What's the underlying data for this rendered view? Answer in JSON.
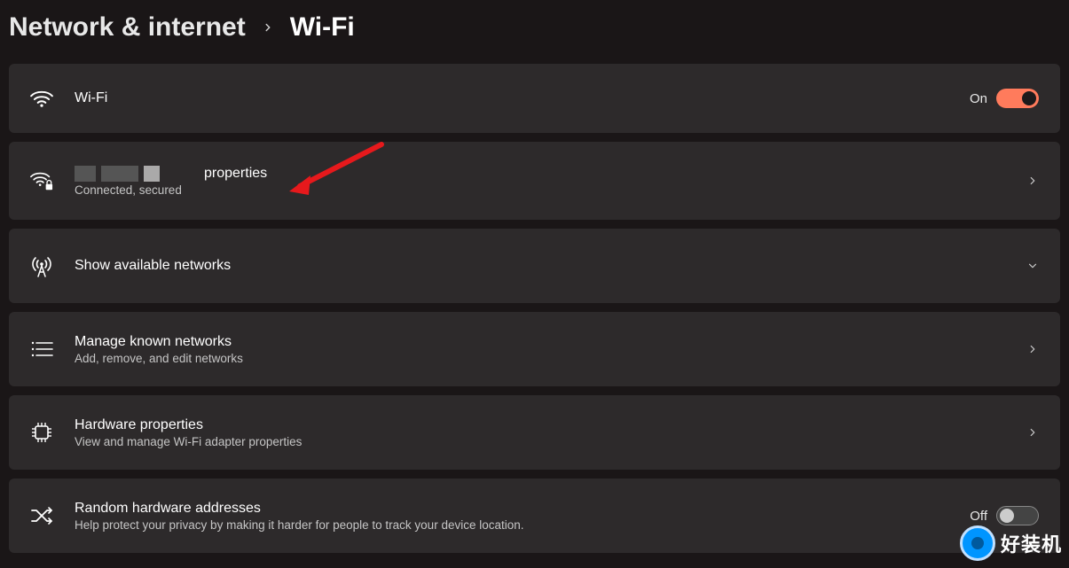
{
  "breadcrumb": {
    "parent": "Network & internet",
    "current": "Wi-Fi"
  },
  "wifi_toggle": {
    "label": "Wi-Fi",
    "state_label": "On",
    "on": true
  },
  "network_props": {
    "suffix": "properties",
    "status": "Connected, secured"
  },
  "available": {
    "label": "Show available networks"
  },
  "manage": {
    "label": "Manage known networks",
    "sub": "Add, remove, and edit networks"
  },
  "hardware": {
    "label": "Hardware properties",
    "sub": "View and manage Wi-Fi adapter properties"
  },
  "random": {
    "label": "Random hardware addresses",
    "sub": "Help protect your privacy by making it harder for people to track your device location.",
    "state_label": "Off",
    "on": false
  },
  "watermark": {
    "text": "好装机"
  }
}
